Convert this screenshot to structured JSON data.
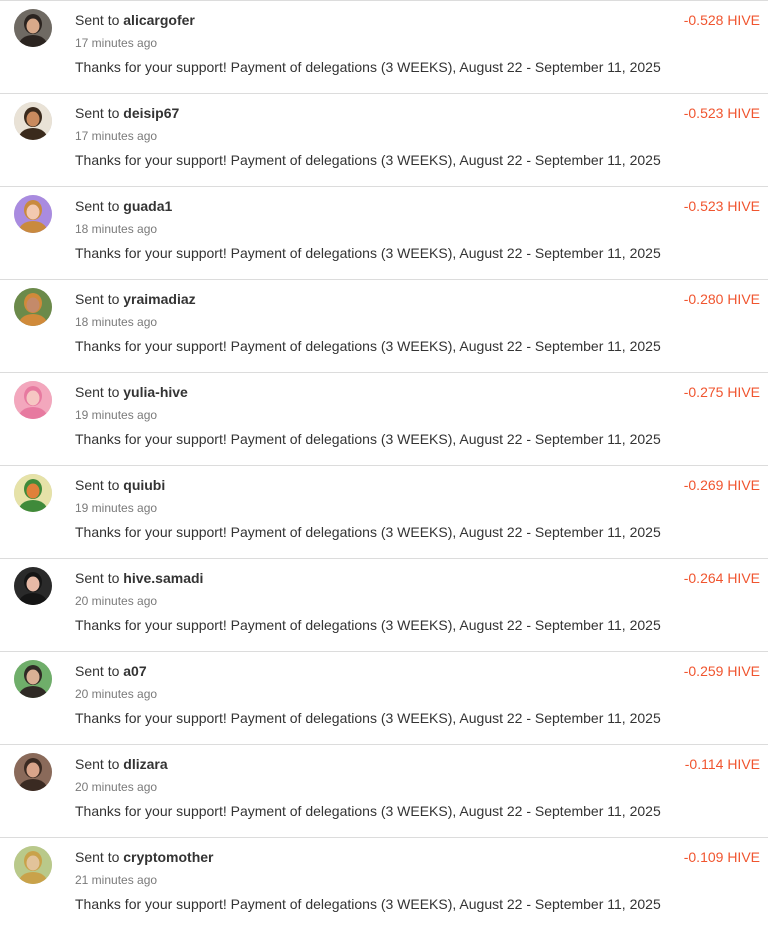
{
  "colors": {
    "amount": "#f0552f",
    "divider": "#dcdcdc",
    "text": "#333333",
    "muted": "#7a7a7a"
  },
  "transfers": [
    {
      "prefix": "Sent to",
      "user": "alicargofer",
      "time": "17 minutes ago",
      "memo": "Thanks for your support! Payment of delegations (3 WEEKS), August 22 - September 11, 2025",
      "amount": "-0.528 HIVE",
      "avatar": {
        "name": "avatar-alicargofer",
        "bg": "#6f6a63",
        "face": "#d8a98a",
        "hair": "#2b2420"
      }
    },
    {
      "prefix": "Sent to",
      "user": "deisip67",
      "time": "17 minutes ago",
      "memo": "Thanks for your support! Payment of delegations (3 WEEKS), August 22 - September 11, 2025",
      "amount": "-0.523 HIVE",
      "avatar": {
        "name": "avatar-deisip67",
        "bg": "#e9e2d6",
        "face": "#c98a5e",
        "hair": "#3a2a1c"
      }
    },
    {
      "prefix": "Sent to",
      "user": "guada1",
      "time": "18 minutes ago",
      "memo": "Thanks for your support! Payment of delegations (3 WEEKS), August 22 - September 11, 2025",
      "amount": "-0.523 HIVE",
      "avatar": {
        "name": "avatar-guada1",
        "bg": "#a98be0",
        "face": "#f3c9b0",
        "hair": "#c98a3e"
      }
    },
    {
      "prefix": "Sent to",
      "user": "yraimadiaz",
      "time": "18 minutes ago",
      "memo": "Thanks for your support! Payment of delegations (3 WEEKS), August 22 - September 11, 2025",
      "amount": "-0.280 HIVE",
      "avatar": {
        "name": "avatar-yraimadiaz",
        "bg": "#6b8a4a",
        "face": "#c48a6a",
        "hair": "#d08a3a"
      }
    },
    {
      "prefix": "Sent to",
      "user": "yulia-hive",
      "time": "19 minutes ago",
      "memo": "Thanks for your support! Payment of delegations (3 WEEKS), August 22 - September 11, 2025",
      "amount": "-0.275 HIVE",
      "avatar": {
        "name": "avatar-yulia-hive",
        "bg": "#f3a7bd",
        "face": "#f6c7c3",
        "hair": "#e77aa0"
      }
    },
    {
      "prefix": "Sent to",
      "user": "quiubi",
      "time": "19 minutes ago",
      "memo": "Thanks for your support! Payment of delegations (3 WEEKS), August 22 - September 11, 2025",
      "amount": "-0.269 HIVE",
      "avatar": {
        "name": "avatar-quiubi",
        "bg": "#e6e2a8",
        "face": "#e0803a",
        "hair": "#3f8a3a"
      }
    },
    {
      "prefix": "Sent to",
      "user": "hive.samadi",
      "time": "20 minutes ago",
      "memo": "Thanks for your support! Payment of delegations (3 WEEKS), August 22 - September 11, 2025",
      "amount": "-0.264 HIVE",
      "avatar": {
        "name": "avatar-hive-samadi",
        "bg": "#2a2a2a",
        "face": "#e7b9a6",
        "hair": "#151515"
      }
    },
    {
      "prefix": "Sent to",
      "user": "a07",
      "time": "20 minutes ago",
      "memo": "Thanks for your support! Payment of delegations (3 WEEKS), August 22 - September 11, 2025",
      "amount": "-0.259 HIVE",
      "avatar": {
        "name": "avatar-a07",
        "bg": "#6fae6a",
        "face": "#d9b095",
        "hair": "#2f2a25"
      }
    },
    {
      "prefix": "Sent to",
      "user": "dlizara",
      "time": "20 minutes ago",
      "memo": "Thanks for your support! Payment of delegations (3 WEEKS), August 22 - September 11, 2025",
      "amount": "-0.114 HIVE",
      "avatar": {
        "name": "avatar-dlizara",
        "bg": "#8a6a5a",
        "face": "#d9a48a",
        "hair": "#3a2a22"
      }
    },
    {
      "prefix": "Sent to",
      "user": "cryptomother",
      "time": "21 minutes ago",
      "memo": "Thanks for your support! Payment of delegations (3 WEEKS), August 22 - September 11, 2025",
      "amount": "-0.109 HIVE",
      "avatar": {
        "name": "avatar-cryptomother",
        "bg": "#b9c98a",
        "face": "#e2c39a",
        "hair": "#c9a24a"
      }
    }
  ]
}
